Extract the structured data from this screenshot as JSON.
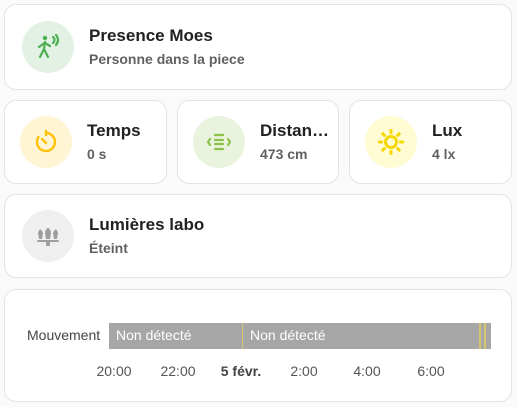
{
  "tiles": [
    {
      "name": "Presence Moes",
      "state": "Personne dans la piece",
      "icon": "motion-sensor-icon",
      "color": "#4caf50"
    },
    {
      "name": "Temps",
      "state": "0 s",
      "icon": "timer-icon",
      "color": "#ffc107"
    },
    {
      "name": "Distan…",
      "state": "473 cm",
      "icon": "distance-icon",
      "color": "#8bc34a"
    },
    {
      "name": "Lux",
      "state": "4 lx",
      "icon": "sun-icon",
      "color": "#ffeb3b"
    },
    {
      "name": "Lumières labo",
      "state": "Éteint",
      "icon": "ceiling-light-icon",
      "color": "#9e9e9e"
    }
  ],
  "history": {
    "entity_label": "Mouvement",
    "segments": [
      "Non détecté",
      "Non détecté"
    ],
    "ticks": [
      "20:00",
      "22:00",
      "5 févr.",
      "2:00",
      "4:00",
      "6:00"
    ]
  }
}
